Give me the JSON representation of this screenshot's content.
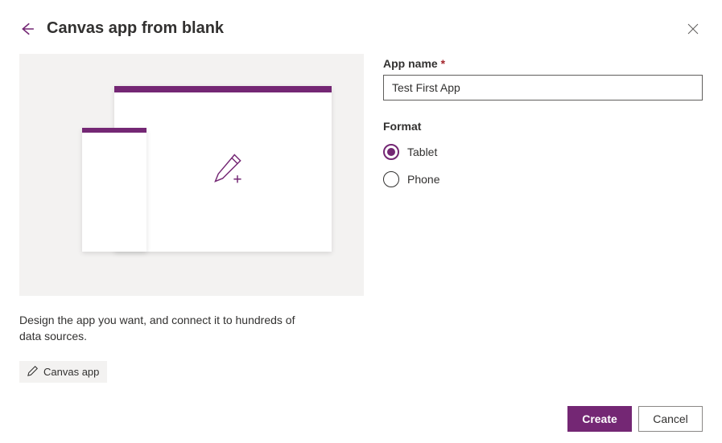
{
  "header": {
    "title": "Canvas app from blank"
  },
  "preview": {
    "description": "Design the app you want, and connect it to hundreds of data sources.",
    "tag_label": "Canvas app"
  },
  "form": {
    "app_name_label": "App name",
    "required_mark": "*",
    "app_name_value": "Test First App",
    "format_label": "Format",
    "options": {
      "tablet": "Tablet",
      "phone": "Phone"
    },
    "selected": "tablet"
  },
  "footer": {
    "create_label": "Create",
    "cancel_label": "Cancel"
  }
}
